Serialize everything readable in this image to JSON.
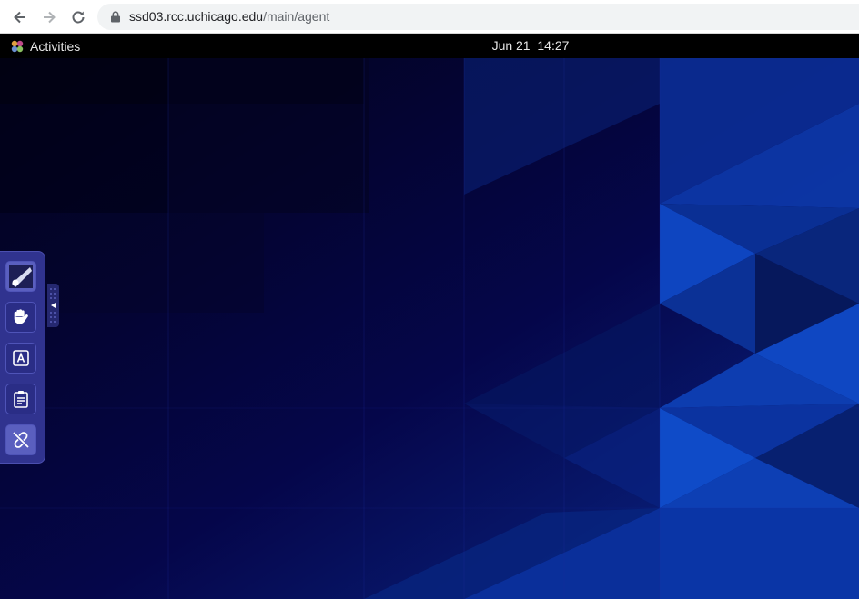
{
  "browser": {
    "url_host": "ssd03.rcc.uchicago.edu",
    "url_path": "/main/agent"
  },
  "topbar": {
    "activities_label": "Activities",
    "clock": "Jun 21  14:27"
  },
  "side_toolbar": {
    "tools": [
      {
        "icon": "pen-brush-icon",
        "active": true
      },
      {
        "icon": "hand-icon",
        "active": false
      },
      {
        "icon": "keyboard-a-icon",
        "active": false
      },
      {
        "icon": "clipboard-icon",
        "active": false
      },
      {
        "icon": "disconnect-icon",
        "active": true
      }
    ]
  },
  "colors": {
    "wallpaper_dark": "#03053a",
    "wallpaper_blue": "#0a3aa8",
    "panel": "#30338f"
  }
}
